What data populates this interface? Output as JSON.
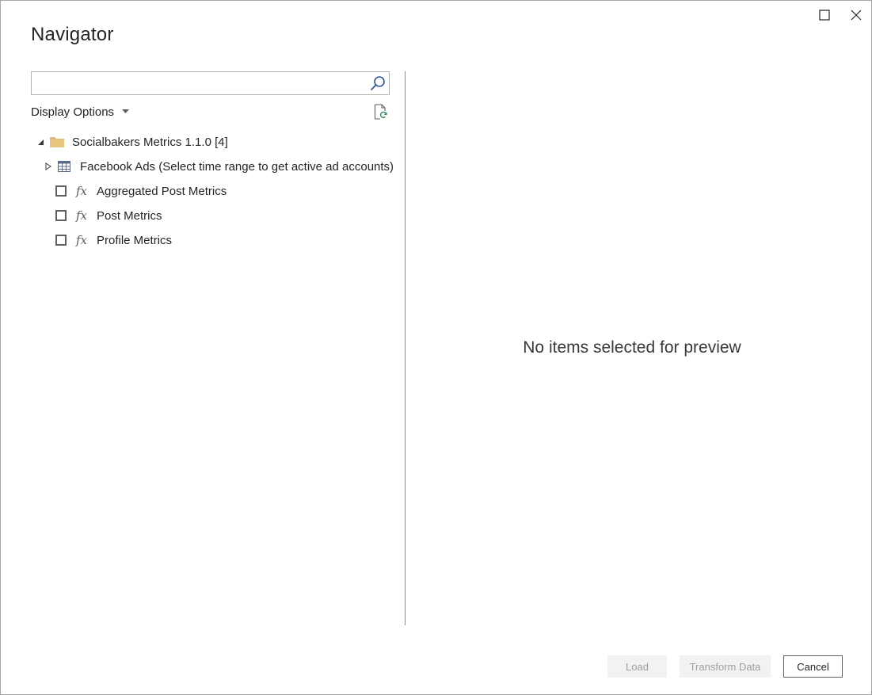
{
  "window": {
    "title": "Navigator"
  },
  "search": {
    "value": "",
    "placeholder": ""
  },
  "display_options": {
    "label": "Display Options"
  },
  "tree": {
    "root": {
      "label": "Socialbakers Metrics 1.1.0 [4]",
      "expanded": true,
      "icon": "folder-icon"
    },
    "items": [
      {
        "label": "Facebook Ads (Select time range to get active ad accounts)",
        "icon": "table-icon",
        "expandable": true
      },
      {
        "label": "Aggregated Post Metrics",
        "icon": "function-icon",
        "checked": false
      },
      {
        "label": "Post Metrics",
        "icon": "function-icon",
        "checked": false
      },
      {
        "label": "Profile Metrics",
        "icon": "function-icon",
        "checked": false
      }
    ]
  },
  "preview": {
    "message": "No items selected for preview"
  },
  "footer": {
    "load_label": "Load",
    "transform_label": "Transform Data",
    "cancel_label": "Cancel"
  },
  "colors": {
    "folder": "#dcb67a",
    "table_icon": "#5b6b8c",
    "refresh_green": "#2e8b57"
  }
}
